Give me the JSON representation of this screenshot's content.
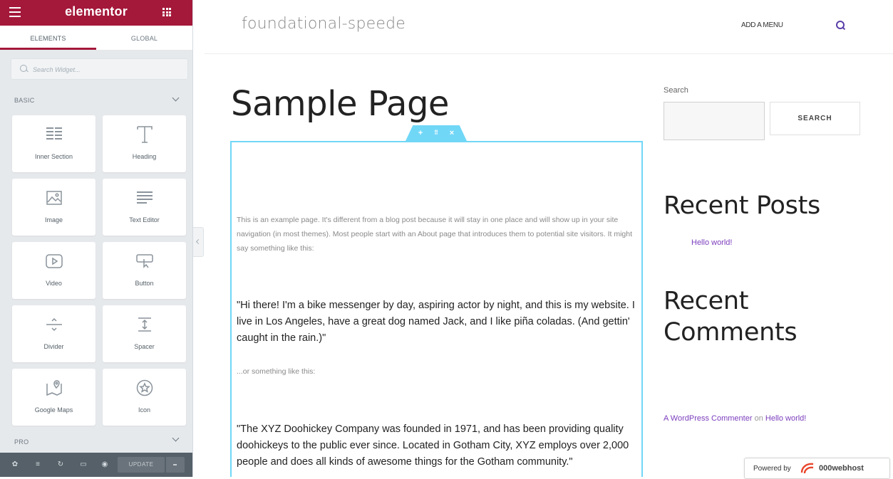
{
  "editor": {
    "app_title": "elementor",
    "tabs": [
      {
        "label": "ELEMENTS"
      },
      {
        "label": "GLOBAL"
      }
    ],
    "search_placeholder": "Search Widget...",
    "sections": {
      "basic": "BASIC",
      "pro": "PRO"
    },
    "widgets": [
      {
        "label": "Inner Section",
        "icon": "inner-section-icon"
      },
      {
        "label": "Heading",
        "icon": "heading-icon"
      },
      {
        "label": "Image",
        "icon": "image-icon"
      },
      {
        "label": "Text Editor",
        "icon": "text-editor-icon"
      },
      {
        "label": "Video",
        "icon": "video-icon"
      },
      {
        "label": "Button",
        "icon": "button-icon"
      },
      {
        "label": "Divider",
        "icon": "divider-icon"
      },
      {
        "label": "Spacer",
        "icon": "spacer-icon"
      },
      {
        "label": "Google Maps",
        "icon": "google-maps-icon"
      },
      {
        "label": "Icon",
        "icon": "star-icon"
      }
    ],
    "footer": {
      "update_label": "UPDATE",
      "icons": [
        "settings-icon",
        "navigator-icon",
        "history-icon",
        "responsive-icon",
        "preview-icon"
      ]
    },
    "accent_color": "#a4183a"
  },
  "site": {
    "title": "foundational-speede",
    "menu_link": "ADD A MENU",
    "page_title": "Sample Page",
    "intro": "This is an example page. It's different from a blog post because it will stay in one place and will show up in your site navigation (in most themes). Most people start with an About page that introduces them to potential site visitors. It might say something like this:",
    "quote1": "\"Hi there! I'm a bike messenger by day, aspiring actor by night, and this is my website. I live in Los Angeles, have a great dog named Jack, and I like piña coladas. (And gettin' caught in the rain.)\"",
    "or_text": "...or something like this:",
    "quote2": "\"The XYZ Doohickey Company was founded in 1971, and has been providing quality doohickeys to the public ever since. Located in Gotham City, XYZ employs over 2,000 people and does all kinds of awesome things for the Gotham community.\""
  },
  "sidebar": {
    "search_label": "Search",
    "search_button": "SEARCH",
    "recent_posts_heading": "Recent Posts",
    "post_link": "Hello world!",
    "recent_comments_heading": "Recent Comments",
    "comment": {
      "author": "A WordPress Commenter",
      "on": "on",
      "post": "Hello world!"
    },
    "link_color": "#7b3dbd"
  },
  "badge": {
    "prefix": "Powered by",
    "brand": "000webhost"
  }
}
